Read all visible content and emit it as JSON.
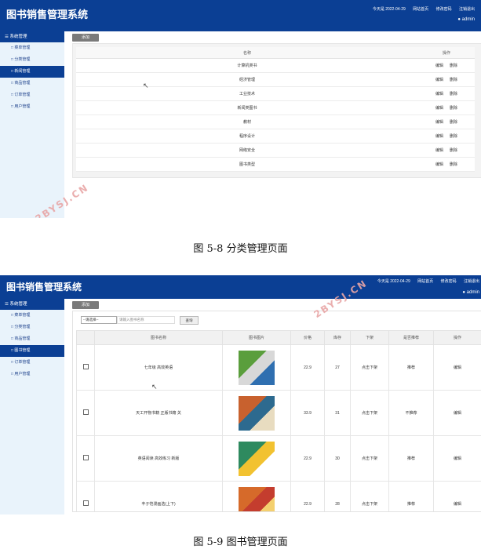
{
  "screen1": {
    "app_title": "图书销售管理系统",
    "header": {
      "date_label": "今天是 2022-04-29",
      "links": [
        "网站首页",
        "修改密码",
        "注销退出"
      ],
      "user": "admin"
    },
    "sidebar": {
      "head": "系统管理",
      "items": [
        {
          "label": "菜单管理",
          "active": false
        },
        {
          "label": "分类管理",
          "active": false
        },
        {
          "label": "新闻管理",
          "active": true
        },
        {
          "label": "商品管理",
          "active": false
        },
        {
          "label": "订单管理",
          "active": false
        },
        {
          "label": "用户管理",
          "active": false
        }
      ]
    },
    "add_button": "添加",
    "table": {
      "headers": [
        "名称",
        "操作"
      ],
      "rows": [
        "计算机类书",
        "经济管理",
        "工业技术",
        "新闻类图书",
        "教材",
        "程序设计",
        "网络安全",
        "图书类型"
      ],
      "actions": [
        "编辑",
        "删除"
      ]
    },
    "watermark": "2BYSJ.CN"
  },
  "caption1": "图 5-8 分类管理页面",
  "screen2": {
    "app_title": "图书销售管理系统",
    "header": {
      "date_label": "今天是 2022-04-29",
      "links": [
        "网站首页",
        "修改密码",
        "注销退出"
      ],
      "user": "admin"
    },
    "sidebar": {
      "head": "系统管理",
      "items": [
        {
          "label": "菜单管理",
          "active": false
        },
        {
          "label": "分类管理",
          "active": false
        },
        {
          "label": "商品管理",
          "active": false
        },
        {
          "label": "图书管理",
          "active": true
        },
        {
          "label": "订单管理",
          "active": false
        },
        {
          "label": "用户管理",
          "active": false
        }
      ]
    },
    "add_button": "添加",
    "search": {
      "select_value": "--请选择--",
      "placeholder": "请输入图书名称",
      "button": "查询"
    },
    "table": {
      "headers": [
        "",
        "图书名称",
        "图书图片",
        "价格",
        "库存",
        "下架",
        "是否推荐",
        "操作"
      ],
      "rows": [
        {
          "name": "七年级 高效英语",
          "price": "22.9",
          "stock": "27",
          "status": "点击下架",
          "recommend": "推荐",
          "action": "编辑",
          "colors": [
            "#5a9e3c",
            "#d8d8d8",
            "#2f6fb0"
          ]
        },
        {
          "name": "天工开物书籍 正版书籍 关",
          "price": "33.9",
          "stock": "31",
          "status": "点击下架",
          "recommend": "不推荐",
          "action": "编辑",
          "colors": [
            "#c8612e",
            "#2d6a8f",
            "#e8dcc0"
          ]
        },
        {
          "name": "英语阅读 高效练习 新版",
          "price": "22.9",
          "stock": "30",
          "status": "点击下架",
          "recommend": "推荐",
          "action": "编辑",
          "colors": [
            "#2e8a5f",
            "#f2c230",
            "#ffffff"
          ]
        },
        {
          "name": "丰子恺漫画选(上下)",
          "price": "22.9",
          "stock": "28",
          "status": "点击下架",
          "recommend": "推荐",
          "action": "编辑",
          "colors": [
            "#d66a2a",
            "#c43d2e",
            "#f4d06f"
          ]
        }
      ]
    },
    "watermark": "2BYSJ.CN"
  },
  "caption2": "图 5-9 图书管理页面"
}
